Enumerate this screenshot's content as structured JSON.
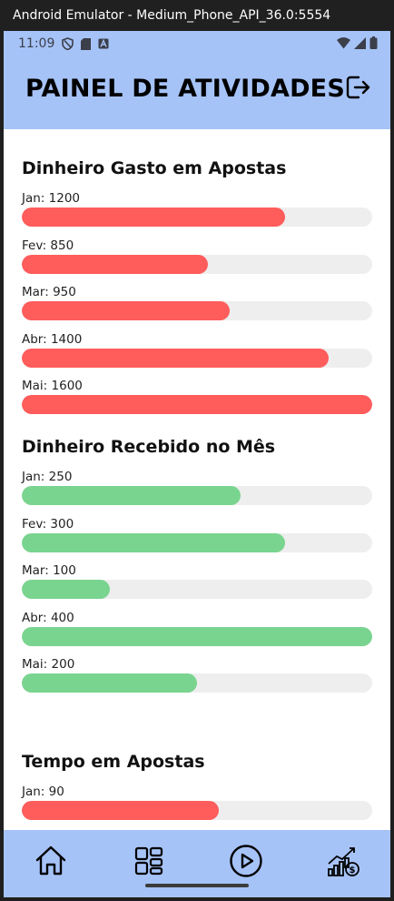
{
  "window": {
    "title": "Android Emulator - Medium_Phone_API_36.0:5554"
  },
  "status_bar": {
    "time": "11:09"
  },
  "header": {
    "title": "PAINEL DE ATIVIDADES"
  },
  "sections": [
    {
      "title": "Dinheiro Gasto em Apostas",
      "color": "#ff5c5c",
      "max": 1600,
      "items": [
        {
          "label": "Jan: 1200",
          "value": 1200
        },
        {
          "label": "Fev: 850",
          "value": 850
        },
        {
          "label": "Mar: 950",
          "value": 950
        },
        {
          "label": "Abr: 1400",
          "value": 1400
        },
        {
          "label": "Mai: 1600",
          "value": 1600
        }
      ]
    },
    {
      "title": "Dinheiro Recebido no Mês",
      "color": "#79d48f",
      "max": 400,
      "items": [
        {
          "label": "Jan: 250",
          "value": 250
        },
        {
          "label": "Fev: 300",
          "value": 300
        },
        {
          "label": "Mar: 100",
          "value": 100
        },
        {
          "label": "Abr: 400",
          "value": 400
        },
        {
          "label": "Mai: 200",
          "value": 200
        }
      ]
    },
    {
      "title": "Tempo em Apostas",
      "color": "#ff5c5c",
      "max": 160,
      "items": [
        {
          "label": "Jan: 90",
          "value": 90
        }
      ]
    }
  ],
  "bottom_nav": [
    {
      "icon": "home-icon"
    },
    {
      "icon": "grid-icon"
    },
    {
      "icon": "play-icon"
    },
    {
      "icon": "stats-money-icon"
    }
  ],
  "colors": {
    "header_bg": "#a6c3f7",
    "track": "#eeeeee"
  }
}
